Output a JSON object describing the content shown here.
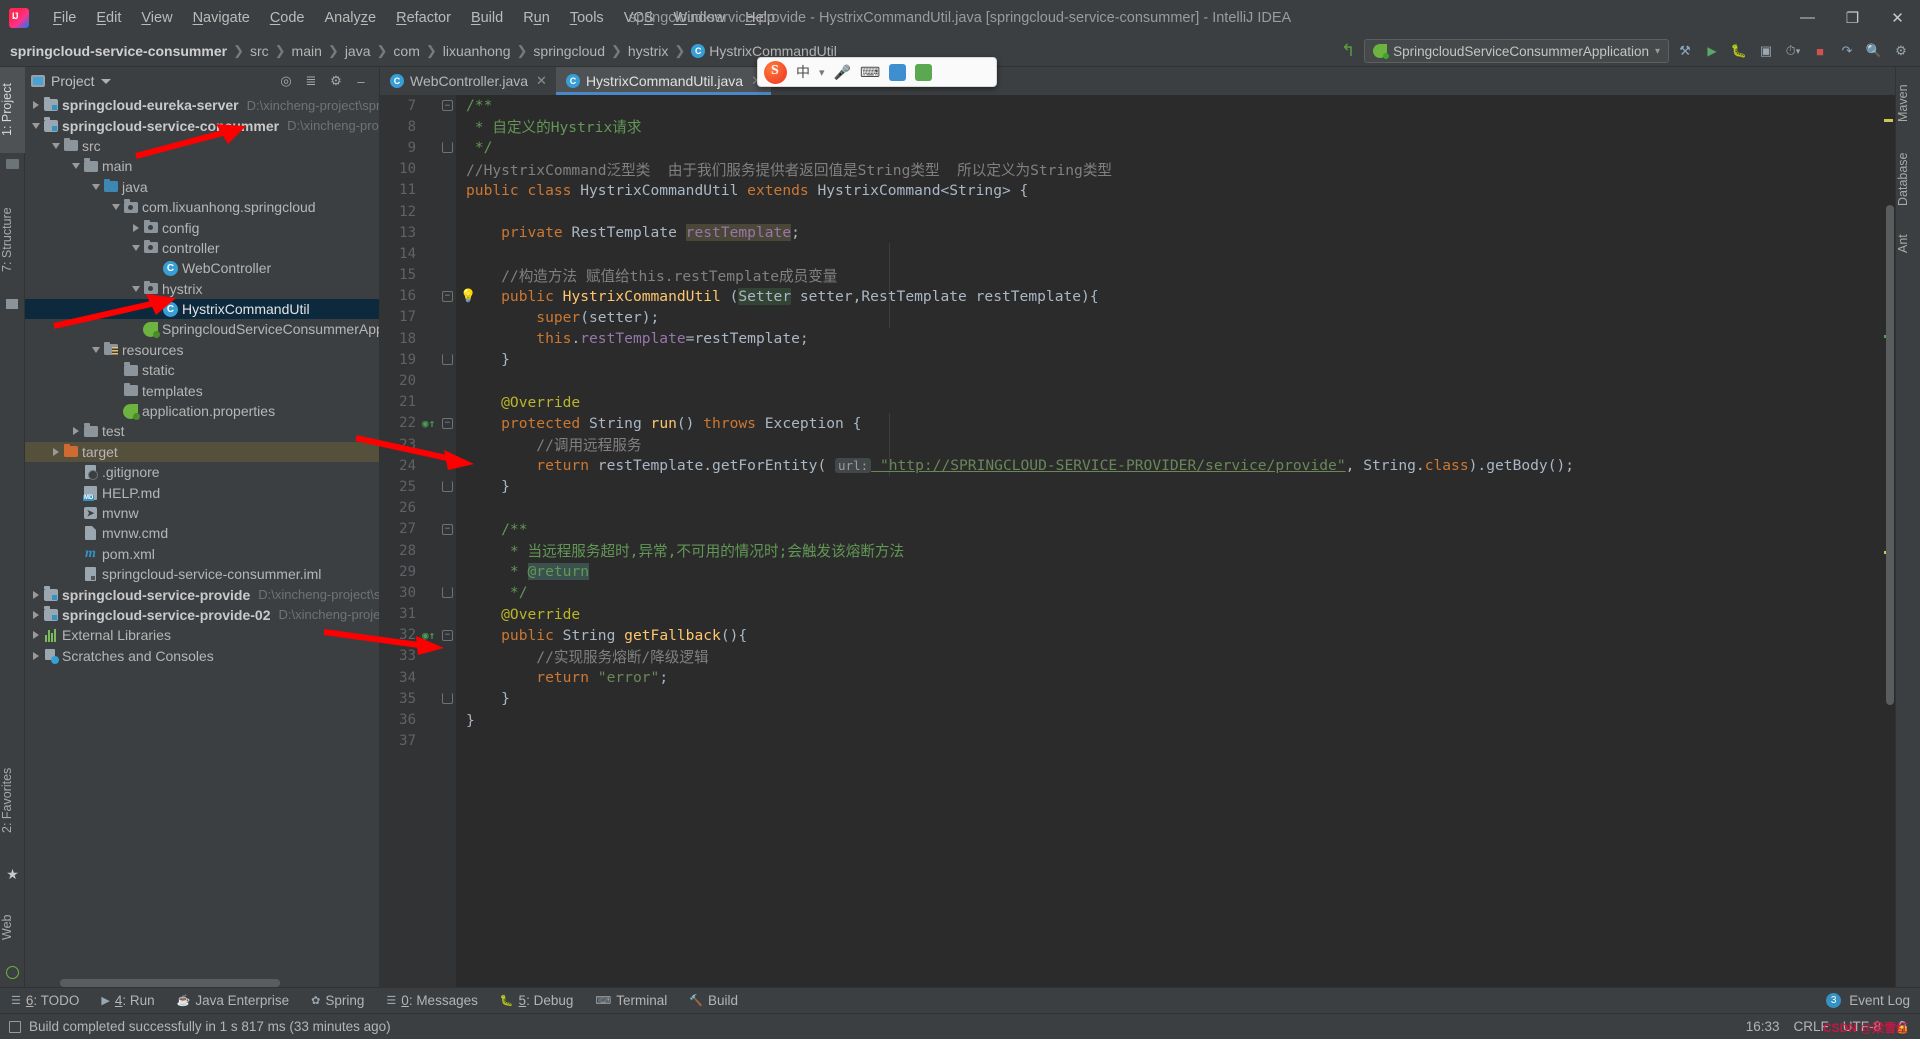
{
  "window": {
    "title": "springcloud-service-provide - HystrixCommandUtil.java [springcloud-service-consummer] - IntelliJ IDEA",
    "minimize": "—",
    "maximize": "❐",
    "close": "✕"
  },
  "menu": {
    "items": [
      {
        "label": "File"
      },
      {
        "label": "Edit"
      },
      {
        "label": "View"
      },
      {
        "label": "Navigate"
      },
      {
        "label": "Code"
      },
      {
        "label": "Analyze"
      },
      {
        "label": "Refactor"
      },
      {
        "label": "Build"
      },
      {
        "label": "Run"
      },
      {
        "label": "Tools"
      },
      {
        "label": "VCS"
      },
      {
        "label": "Window"
      },
      {
        "label": "Help"
      }
    ]
  },
  "breadcrumb": {
    "items": [
      "springcloud-service-consummer",
      "src",
      "main",
      "java",
      "com",
      "lixuanhong",
      "springcloud",
      "hystrix"
    ],
    "file": "HystrixCommandUtil",
    "file_icon": "C"
  },
  "toolbar": {
    "run_config": "SpringcloudServiceConsummerApplication",
    "run_config_caret": "▾",
    "build_icon": "⚒",
    "run_icon": "▶",
    "debug_icon": "🐞",
    "coverage_icon": "⬚",
    "profile_icon": "⚐",
    "stop_icon": "■",
    "search_icon": "🔍",
    "settings_icon": "⚙",
    "back_icon": "↖"
  },
  "left_strip": {
    "tabs": [
      {
        "label": "1: Project",
        "active": true
      },
      {
        "label": "7: Structure",
        "active": false
      },
      {
        "label": "2: Favorites",
        "active": false
      },
      {
        "label": "Web",
        "active": false
      }
    ]
  },
  "right_strip": {
    "tabs": [
      {
        "label": "Maven"
      },
      {
        "label": "Database"
      },
      {
        "label": "Ant"
      }
    ]
  },
  "project_panel": {
    "title": "Project",
    "caret": "▾",
    "actions": [
      "locate-icon",
      "collapse-all-icon",
      "settings-icon",
      "hide-icon"
    ],
    "tree": [
      {
        "depth": 0,
        "twist": "right",
        "icon": "module",
        "label": "springcloud-eureka-server",
        "bold": true,
        "path": "D:\\xincheng-project\\spri"
      },
      {
        "depth": 0,
        "twist": "down",
        "icon": "module",
        "label": "springcloud-service-consummer",
        "bold": true,
        "path": "D:\\xincheng-projec"
      },
      {
        "depth": 1,
        "twist": "down",
        "icon": "folder",
        "label": "src",
        "bold": false,
        "path": ""
      },
      {
        "depth": 2,
        "twist": "down",
        "icon": "folder",
        "label": "main",
        "bold": false,
        "path": ""
      },
      {
        "depth": 3,
        "twist": "down",
        "icon": "folder-blue",
        "label": "java",
        "bold": false,
        "path": ""
      },
      {
        "depth": 4,
        "twist": "down",
        "icon": "package",
        "label": "com.lixuanhong.springcloud",
        "bold": false,
        "path": ""
      },
      {
        "depth": 5,
        "twist": "right",
        "icon": "package",
        "label": "config",
        "bold": false,
        "path": ""
      },
      {
        "depth": 5,
        "twist": "down",
        "icon": "package",
        "label": "controller",
        "bold": false,
        "path": ""
      },
      {
        "depth": 6,
        "twist": "none",
        "icon": "class",
        "label": "WebController",
        "bold": false,
        "path": ""
      },
      {
        "depth": 5,
        "twist": "down",
        "icon": "package",
        "label": "hystrix",
        "bold": false,
        "path": ""
      },
      {
        "depth": 6,
        "twist": "none",
        "icon": "class",
        "label": "HystrixCommandUtil",
        "bold": false,
        "path": "",
        "selected": true
      },
      {
        "depth": 5,
        "twist": "none",
        "icon": "springboot",
        "label": "SpringcloudServiceConsummerApplic",
        "bold": false,
        "path": ""
      },
      {
        "depth": 3,
        "twist": "down",
        "icon": "resources",
        "label": "resources",
        "bold": false,
        "path": ""
      },
      {
        "depth": 4,
        "twist": "none",
        "icon": "folder",
        "label": "static",
        "bold": false,
        "path": ""
      },
      {
        "depth": 4,
        "twist": "none",
        "icon": "folder",
        "label": "templates",
        "bold": false,
        "path": ""
      },
      {
        "depth": 4,
        "twist": "none",
        "icon": "springboot",
        "label": "application.properties",
        "bold": false,
        "path": ""
      },
      {
        "depth": 2,
        "twist": "right",
        "icon": "folder",
        "label": "test",
        "bold": false,
        "path": ""
      },
      {
        "depth": 1,
        "twist": "right",
        "icon": "folder-orange",
        "label": "target",
        "bold": false,
        "path": "",
        "excluded": true
      },
      {
        "depth": 2,
        "twist": "none",
        "icon": "gitignore",
        "label": ".gitignore",
        "bold": false,
        "path": ""
      },
      {
        "depth": 2,
        "twist": "none",
        "icon": "md",
        "label": "HELP.md",
        "bold": false,
        "path": ""
      },
      {
        "depth": 2,
        "twist": "none",
        "icon": "sh",
        "label": "mvnw",
        "bold": false,
        "path": ""
      },
      {
        "depth": 2,
        "twist": "none",
        "icon": "file",
        "label": "mvnw.cmd",
        "bold": false,
        "path": ""
      },
      {
        "depth": 2,
        "twist": "none",
        "icon": "maven",
        "label": "pom.xml",
        "bold": false,
        "path": ""
      },
      {
        "depth": 2,
        "twist": "none",
        "icon": "iml",
        "label": "springcloud-service-consummer.iml",
        "bold": false,
        "path": ""
      },
      {
        "depth": 0,
        "twist": "right",
        "icon": "module",
        "label": "springcloud-service-provide",
        "bold": true,
        "path": "D:\\xincheng-project\\sp"
      },
      {
        "depth": 0,
        "twist": "right",
        "icon": "module",
        "label": "springcloud-service-provide-02",
        "bold": true,
        "path": "D:\\xincheng-project"
      },
      {
        "depth": 0,
        "twist": "right",
        "icon": "library",
        "label": "External Libraries",
        "bold": false,
        "path": ""
      },
      {
        "depth": 0,
        "twist": "right",
        "icon": "scratch",
        "label": "Scratches and Consoles",
        "bold": false,
        "path": ""
      }
    ]
  },
  "editor": {
    "tabs": [
      {
        "label": "WebController.java",
        "icon": "C",
        "active": false,
        "close": "✕"
      },
      {
        "label": "HystrixCommandUtil.java",
        "icon": "C",
        "active": true,
        "close": "✕"
      }
    ],
    "first_line": 7,
    "lines": [
      {
        "n": 7,
        "fold": "minus",
        "tokens": [
          {
            "t": "/**",
            "c": "doc"
          }
        ]
      },
      {
        "n": 8,
        "tokens": [
          {
            "t": " * ",
            "c": "doc"
          },
          {
            "t": "自定义的Hystrix请求",
            "c": "doc"
          }
        ]
      },
      {
        "n": 9,
        "fold": "end",
        "tokens": [
          {
            "t": " */",
            "c": "doc"
          }
        ]
      },
      {
        "n": 10,
        "tokens": [
          {
            "t": "//HystrixCommand泛型类  由于我们服务提供者返回值是String类型  所以定义为String类型",
            "c": "cmt"
          }
        ]
      },
      {
        "n": 11,
        "tokens": [
          {
            "t": "public ",
            "c": "kw"
          },
          {
            "t": "class ",
            "c": "kw"
          },
          {
            "t": "HystrixCommandUtil ",
            "c": "def"
          },
          {
            "t": "extends ",
            "c": "kw"
          },
          {
            "t": "HystrixCommand<String> {",
            "c": "def"
          }
        ]
      },
      {
        "n": 12,
        "tokens": []
      },
      {
        "n": 13,
        "indent": 1,
        "tokens": [
          {
            "t": "    private ",
            "c": "kw"
          },
          {
            "t": "RestTemplate ",
            "c": "def"
          },
          {
            "t": "restTemplate",
            "c": "fld hl-field"
          },
          {
            "t": ";",
            "c": "def"
          }
        ]
      },
      {
        "n": 14,
        "indent": 1,
        "tokens": []
      },
      {
        "n": 15,
        "indent": 1,
        "tokens": [
          {
            "t": "    //构造方法 赋值给this.restTemplate成员变量",
            "c": "cmt"
          }
        ]
      },
      {
        "n": 16,
        "indent": 1,
        "fold": "minus",
        "bulb": true,
        "tokens": [
          {
            "t": "    public ",
            "c": "kw"
          },
          {
            "t": "HystrixCommandUtil ",
            "c": "mth"
          },
          {
            "t": "(",
            "c": "def"
          },
          {
            "t": "Setter",
            "c": "def hl-param"
          },
          {
            "t": " setter,RestTemplate restTemplate){",
            "c": "def"
          }
        ]
      },
      {
        "n": 17,
        "indent": 2,
        "tokens": [
          {
            "t": "        super",
            "c": "kw"
          },
          {
            "t": "(setter);",
            "c": "def"
          }
        ]
      },
      {
        "n": 18,
        "indent": 2,
        "tokens": [
          {
            "t": "        this",
            "c": "kw"
          },
          {
            "t": ".",
            "c": "def"
          },
          {
            "t": "restTemplate",
            "c": "fld"
          },
          {
            "t": "=restTemplate;",
            "c": "def"
          }
        ]
      },
      {
        "n": 19,
        "indent": 1,
        "fold": "end",
        "tokens": [
          {
            "t": "    }",
            "c": "def"
          }
        ]
      },
      {
        "n": 20,
        "indent": 1,
        "tokens": []
      },
      {
        "n": 21,
        "indent": 1,
        "tokens": [
          {
            "t": "    @Override",
            "c": "ann"
          }
        ]
      },
      {
        "n": 22,
        "indent": 1,
        "fold": "minus",
        "override": true,
        "tokens": [
          {
            "t": "    protected ",
            "c": "kw"
          },
          {
            "t": "String ",
            "c": "def"
          },
          {
            "t": "run",
            "c": "mth"
          },
          {
            "t": "() ",
            "c": "def"
          },
          {
            "t": "throws ",
            "c": "kw"
          },
          {
            "t": "Exception {",
            "c": "def"
          }
        ]
      },
      {
        "n": 23,
        "indent": 2,
        "tokens": [
          {
            "t": "        //调用远程服务",
            "c": "cmt"
          }
        ]
      },
      {
        "n": 24,
        "indent": 2,
        "tokens": [
          {
            "t": "        return ",
            "c": "kw"
          },
          {
            "t": "restTemplate.",
            "c": "def"
          },
          {
            "t": "getForEntity",
            "c": "def"
          },
          {
            "t": "( ",
            "c": "def"
          },
          {
            "t": "url:",
            "c": "hint"
          },
          {
            "t": " \"http://SPRINGCLOUD-SERVICE-PROVIDER/service/provide\"",
            "c": "link-str"
          },
          {
            "t": ", String.",
            "c": "def"
          },
          {
            "t": "class",
            "c": "kw"
          },
          {
            "t": ").getBody();",
            "c": "def"
          }
        ]
      },
      {
        "n": 25,
        "indent": 1,
        "fold": "end",
        "tokens": [
          {
            "t": "    }",
            "c": "def"
          }
        ]
      },
      {
        "n": 26,
        "indent": 1,
        "tokens": []
      },
      {
        "n": 27,
        "indent": 1,
        "fold": "minus",
        "tokens": [
          {
            "t": "    /**",
            "c": "doc"
          }
        ]
      },
      {
        "n": 28,
        "indent": 1,
        "tokens": [
          {
            "t": "     * 当远程服务超时,异常,不可用的情况时;会触发该熔断方法",
            "c": "doc"
          }
        ]
      },
      {
        "n": 29,
        "indent": 1,
        "tokens": [
          {
            "t": "     * ",
            "c": "doc"
          },
          {
            "t": "@return",
            "c": "doc hl-ret"
          }
        ]
      },
      {
        "n": 30,
        "indent": 1,
        "fold": "end",
        "tokens": [
          {
            "t": "     */",
            "c": "doc"
          }
        ]
      },
      {
        "n": 31,
        "indent": 1,
        "tokens": [
          {
            "t": "    @Override",
            "c": "ann"
          }
        ]
      },
      {
        "n": 32,
        "indent": 1,
        "fold": "minus",
        "override": true,
        "tokens": [
          {
            "t": "    public ",
            "c": "kw"
          },
          {
            "t": "String ",
            "c": "def"
          },
          {
            "t": "getFallback",
            "c": "mth"
          },
          {
            "t": "(){",
            "c": "def"
          }
        ]
      },
      {
        "n": 33,
        "indent": 2,
        "tokens": [
          {
            "t": "        //实现服务熔断/降级逻辑",
            "c": "cmt"
          }
        ]
      },
      {
        "n": 34,
        "indent": 2,
        "tokens": [
          {
            "t": "        return ",
            "c": "kw"
          },
          {
            "t": "\"error\"",
            "c": "str"
          },
          {
            "t": ";",
            "c": "def"
          }
        ]
      },
      {
        "n": 35,
        "indent": 1,
        "fold": "end",
        "tokens": [
          {
            "t": "    }",
            "c": "def"
          }
        ]
      },
      {
        "n": 36,
        "tokens": [
          {
            "t": "}",
            "c": "def"
          }
        ]
      },
      {
        "n": 37,
        "tokens": []
      }
    ]
  },
  "ime": {
    "app_name": "S",
    "lang": "中",
    "dropdown": "▾",
    "mic_icon": "🎤",
    "keyboard_icon": "⌨",
    "toolbox_icon": "🧰",
    "apps_icon": "⊞"
  },
  "bottom_bar": {
    "items": [
      {
        "label": "6: TODO",
        "icon": "list-icon",
        "mn": "6"
      },
      {
        "label": "4: Run",
        "icon": "run-icon",
        "mn": "4"
      },
      {
        "label": "Java Enterprise",
        "icon": "java-icon",
        "mn": ""
      },
      {
        "label": "Spring",
        "icon": "spring-icon",
        "mn": ""
      },
      {
        "label": "0: Messages",
        "icon": "messages-icon",
        "mn": "0"
      },
      {
        "label": "5: Debug",
        "icon": "debug-icon",
        "mn": "5"
      },
      {
        "label": "Terminal",
        "icon": "terminal-icon",
        "mn": ""
      },
      {
        "label": "Build",
        "icon": "build-icon",
        "mn": ""
      }
    ],
    "event_log": "Event Log",
    "event_count": "3"
  },
  "status_bar": {
    "message": "Build completed successfully in 1 s 817 ms (33 minutes ago)",
    "time": "16:33",
    "line_sep": "CRLF",
    "encoding": "UTF-8",
    "lock_icon": "🔒",
    "watermark": "CSDN @梁雪红"
  },
  "colors": {
    "bg": "#3c3f41",
    "editor_bg": "#2b2b2b",
    "gutter_bg": "#313335",
    "accent": "#4a88c7",
    "selection": "#0d293e",
    "excluded": "#55503c",
    "arrow": "#ff0000"
  }
}
